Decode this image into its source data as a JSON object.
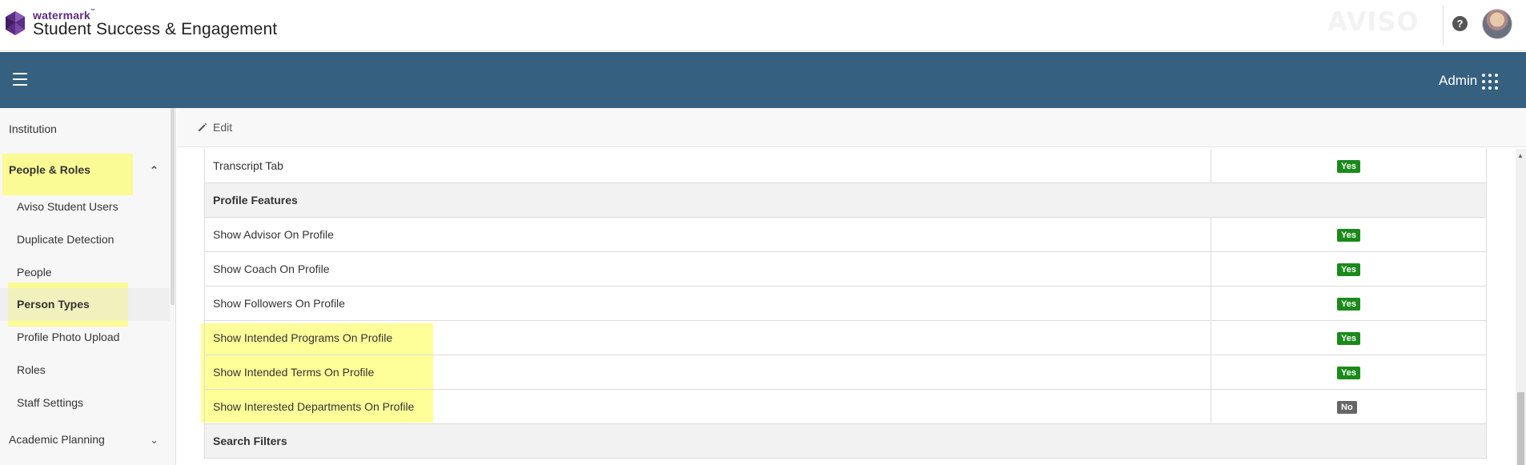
{
  "header": {
    "brand_small": "watermark",
    "brand_tm": "™",
    "brand_name": "Student Success & Engagement",
    "partner_logo": "AVISO",
    "help_icon": "question-circle-icon"
  },
  "navbar": {
    "menu_icon": "hamburger-icon",
    "admin_label": "Admin",
    "apps_icon": "apps-grid-icon"
  },
  "sidebar": {
    "items": [
      {
        "label": "Institution"
      },
      {
        "label": "People & Roles"
      },
      {
        "label": "Aviso Student Users"
      },
      {
        "label": "Duplicate Detection"
      },
      {
        "label": "People"
      },
      {
        "label": "Person Types"
      },
      {
        "label": "Profile Photo Upload"
      },
      {
        "label": "Roles"
      },
      {
        "label": "Staff Settings"
      },
      {
        "label": "Academic Planning"
      }
    ]
  },
  "toolbar": {
    "edit_label": "Edit"
  },
  "table": {
    "rows": [
      {
        "label": "Transcript Tab",
        "value": "Yes"
      },
      {
        "label": "Profile Features"
      },
      {
        "label": "Show Advisor On Profile",
        "value": "Yes"
      },
      {
        "label": "Show Coach On Profile",
        "value": "Yes"
      },
      {
        "label": "Show Followers On Profile",
        "value": "Yes"
      },
      {
        "label": "Show Intended Programs On Profile",
        "value": "Yes"
      },
      {
        "label": "Show Intended Terms On Profile",
        "value": "Yes"
      },
      {
        "label": "Show Interested Departments On Profile",
        "value": "No"
      },
      {
        "label": "Search Filters"
      }
    ]
  },
  "colors": {
    "navbar": "#35607f",
    "yes_badge": "#1a8a1a",
    "no_badge": "#666666",
    "highlight": "#ffff46",
    "brand_purple": "#5b2d83"
  }
}
